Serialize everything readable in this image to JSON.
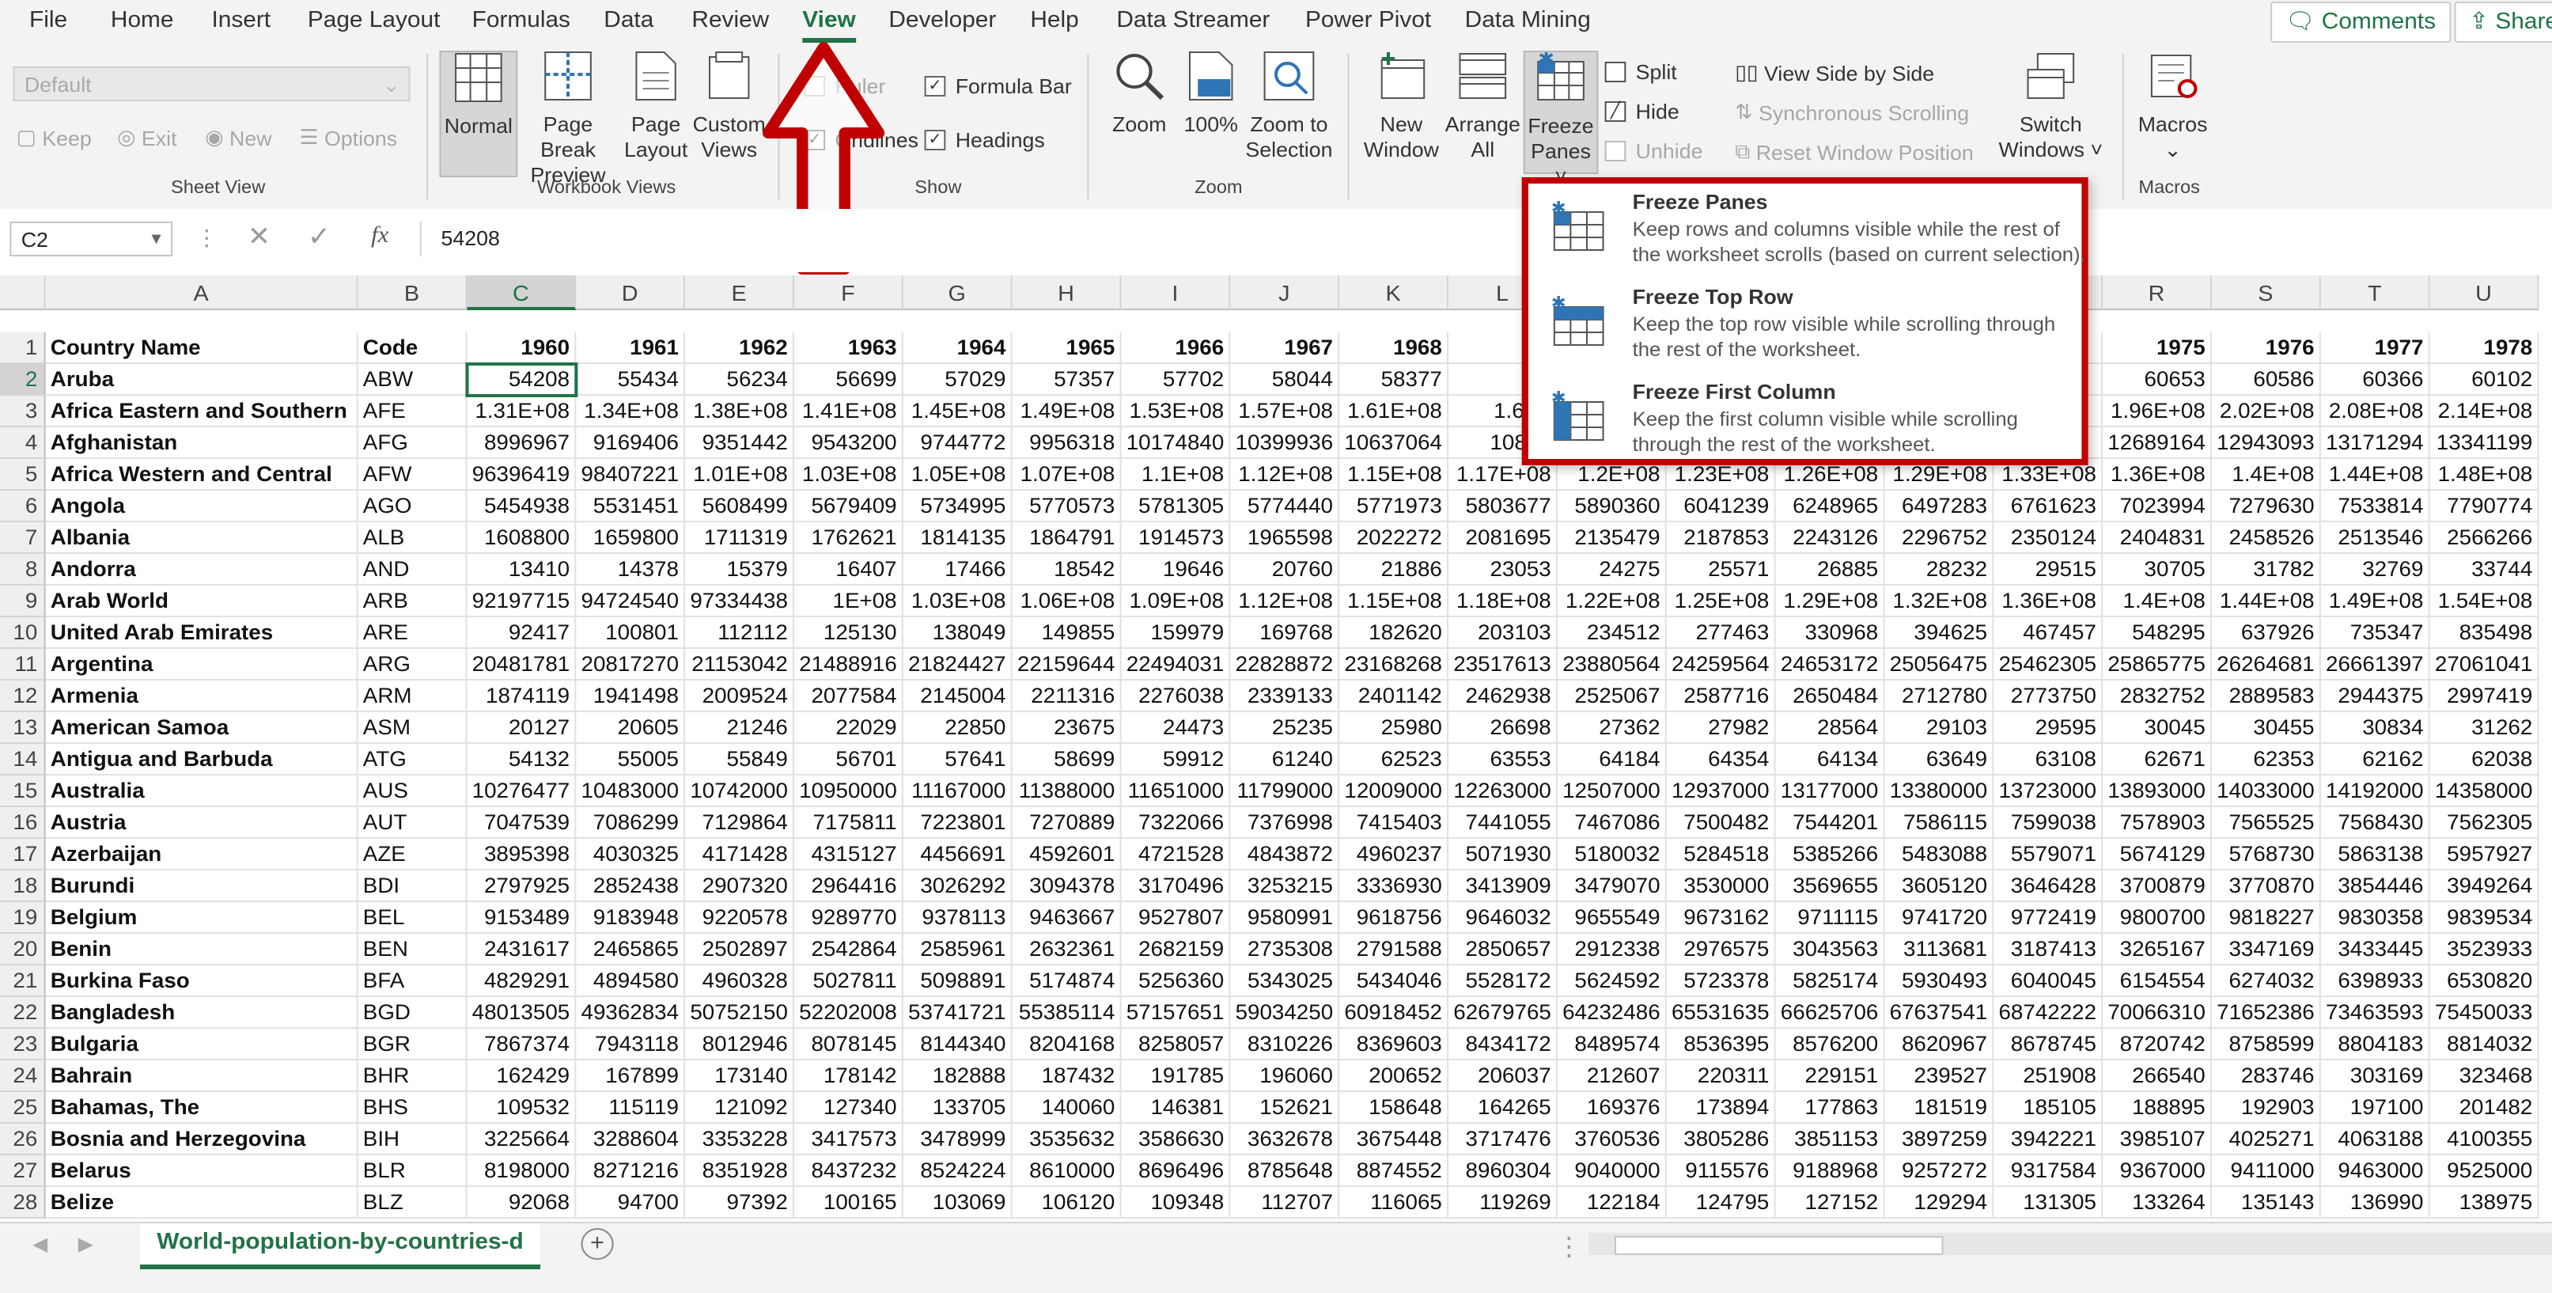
{
  "menu": {
    "tabs": [
      "File",
      "Home",
      "Insert",
      "Page Layout",
      "Formulas",
      "Data",
      "Review",
      "View",
      "Developer",
      "Help",
      "Data Streamer",
      "Power Pivot",
      "Data Mining"
    ],
    "active_tab": "View",
    "comments_label": "Comments",
    "share_label": "Share"
  },
  "ribbon": {
    "sheet_view": {
      "dropdown_value": "Default",
      "keep": "Keep",
      "exit": "Exit",
      "new": "New",
      "options": "Options",
      "group_label": "Sheet View"
    },
    "workbook_views": {
      "normal": "Normal",
      "page_break_1": "Page Break",
      "page_break_2": "Preview",
      "page_layout_1": "Page",
      "page_layout_2": "Layout",
      "custom_views_1": "Custom",
      "custom_views_2": "Views",
      "group_label": "Workbook Views"
    },
    "show": {
      "ruler": "Ruler",
      "formula_bar": "Formula Bar",
      "gridlines": "Gridlines",
      "headings": "Headings",
      "group_label": "Show"
    },
    "zoom": {
      "zoom": "Zoom",
      "hundred": "100%",
      "zoom_sel_1": "Zoom to",
      "zoom_sel_2": "Selection",
      "group_label": "Zoom"
    },
    "window": {
      "new_window_1": "New",
      "new_window_2": "Window",
      "arrange_1": "Arrange",
      "arrange_2": "All",
      "freeze_1": "Freeze",
      "freeze_2": "Panes ˅",
      "split": "Split",
      "hide": "Hide",
      "unhide": "Unhide",
      "side_by_side": "View Side by Side",
      "sync_scroll": "Synchronous Scrolling",
      "reset_pos": "Reset Window Position",
      "switch_1": "Switch",
      "switch_2": "Windows ˅"
    },
    "macros": {
      "label": "Macros",
      "group_label": "Macros"
    }
  },
  "formula_bar": {
    "name_box": "C2",
    "fx": "fx",
    "value": "54208"
  },
  "freeze_menu": {
    "items": [
      {
        "title": "Freeze Panes",
        "desc": "Keep rows and columns visible while the rest of the worksheet scrolls (based on current selection)."
      },
      {
        "title": "Freeze Top Row",
        "desc": "Keep the top row visible while scrolling through the rest of the worksheet."
      },
      {
        "title": "Freeze First Column",
        "desc": "Keep the first column visible while scrolling through the rest of the worksheet."
      }
    ]
  },
  "sheet_tab": "World-population-by-countries-d",
  "colors": {
    "accent": "#217346",
    "highlight": "#c00000"
  },
  "grid": {
    "columns": [
      "A",
      "B",
      "C",
      "D",
      "E",
      "F",
      "G",
      "H",
      "I",
      "J",
      "K",
      "L",
      "M",
      "N",
      "O",
      "P",
      "Q",
      "R",
      "S",
      "T",
      "U"
    ],
    "visible_headers": [
      "A",
      "B",
      "C",
      "D",
      "E",
      "F",
      "G",
      "H",
      "I",
      "J",
      "K",
      "L",
      "R",
      "S",
      "T",
      "U"
    ],
    "header_row": [
      "Country Name",
      "Code",
      "1960",
      "1961",
      "1962",
      "1963",
      "1964",
      "1965",
      "1966",
      "1967",
      "1968",
      "19",
      "",
      "",
      "",
      "",
      "",
      "1975",
      "1976",
      "1977",
      "1978"
    ],
    "rows": [
      [
        "Aruba",
        "ABW",
        "54208",
        "55434",
        "56234",
        "56699",
        "57029",
        "57357",
        "57702",
        "58044",
        "58377",
        "58",
        "",
        "",
        "",
        "",
        "",
        "60653",
        "60586",
        "60366",
        "60102"
      ],
      [
        "Africa Eastern and Southern",
        "AFE",
        "1.31E+08",
        "1.34E+08",
        "1.38E+08",
        "1.41E+08",
        "1.45E+08",
        "1.49E+08",
        "1.53E+08",
        "1.57E+08",
        "1.61E+08",
        "1.66E",
        "",
        "",
        "",
        "",
        "",
        "1.96E+08",
        "2.02E+08",
        "2.08E+08",
        "2.14E+08"
      ],
      [
        "Afghanistan",
        "AFG",
        "8996967",
        "9169406",
        "9351442",
        "9543200",
        "9744772",
        "9956318",
        "10174840",
        "10399936",
        "10637064",
        "10893",
        "",
        "",
        "",
        "",
        "",
        "12689164",
        "12943093",
        "13171294",
        "13341199"
      ],
      [
        "Africa Western and Central",
        "AFW",
        "96396419",
        "98407221",
        "1.01E+08",
        "1.03E+08",
        "1.05E+08",
        "1.07E+08",
        "1.1E+08",
        "1.12E+08",
        "1.15E+08",
        "1.17E+08",
        "1.2E+08",
        "1.23E+08",
        "1.26E+08",
        "1.29E+08",
        "1.33E+08",
        "1.36E+08",
        "1.4E+08",
        "1.44E+08",
        "1.48E+08"
      ],
      [
        "Angola",
        "AGO",
        "5454938",
        "5531451",
        "5608499",
        "5679409",
        "5734995",
        "5770573",
        "5781305",
        "5774440",
        "5771973",
        "5803677",
        "5890360",
        "6041239",
        "6248965",
        "6497283",
        "6761623",
        "7023994",
        "7279630",
        "7533814",
        "7790774"
      ],
      [
        "Albania",
        "ALB",
        "1608800",
        "1659800",
        "1711319",
        "1762621",
        "1814135",
        "1864791",
        "1914573",
        "1965598",
        "2022272",
        "2081695",
        "2135479",
        "2187853",
        "2243126",
        "2296752",
        "2350124",
        "2404831",
        "2458526",
        "2513546",
        "2566266"
      ],
      [
        "Andorra",
        "AND",
        "13410",
        "14378",
        "15379",
        "16407",
        "17466",
        "18542",
        "19646",
        "20760",
        "21886",
        "23053",
        "24275",
        "25571",
        "26885",
        "28232",
        "29515",
        "30705",
        "31782",
        "32769",
        "33744"
      ],
      [
        "Arab World",
        "ARB",
        "92197715",
        "94724540",
        "97334438",
        "1E+08",
        "1.03E+08",
        "1.06E+08",
        "1.09E+08",
        "1.12E+08",
        "1.15E+08",
        "1.18E+08",
        "1.22E+08",
        "1.25E+08",
        "1.29E+08",
        "1.32E+08",
        "1.36E+08",
        "1.4E+08",
        "1.44E+08",
        "1.49E+08",
        "1.54E+08"
      ],
      [
        "United Arab Emirates",
        "ARE",
        "92417",
        "100801",
        "112112",
        "125130",
        "138049",
        "149855",
        "159979",
        "169768",
        "182620",
        "203103",
        "234512",
        "277463",
        "330968",
        "394625",
        "467457",
        "548295",
        "637926",
        "735347",
        "835498"
      ],
      [
        "Argentina",
        "ARG",
        "20481781",
        "20817270",
        "21153042",
        "21488916",
        "21824427",
        "22159644",
        "22494031",
        "22828872",
        "23168268",
        "23517613",
        "23880564",
        "24259564",
        "24653172",
        "25056475",
        "25462305",
        "25865775",
        "26264681",
        "26661397",
        "27061041"
      ],
      [
        "Armenia",
        "ARM",
        "1874119",
        "1941498",
        "2009524",
        "2077584",
        "2145004",
        "2211316",
        "2276038",
        "2339133",
        "2401142",
        "2462938",
        "2525067",
        "2587716",
        "2650484",
        "2712780",
        "2773750",
        "2832752",
        "2889583",
        "2944375",
        "2997419"
      ],
      [
        "American Samoa",
        "ASM",
        "20127",
        "20605",
        "21246",
        "22029",
        "22850",
        "23675",
        "24473",
        "25235",
        "25980",
        "26698",
        "27362",
        "27982",
        "28564",
        "29103",
        "29595",
        "30045",
        "30455",
        "30834",
        "31262"
      ],
      [
        "Antigua and Barbuda",
        "ATG",
        "54132",
        "55005",
        "55849",
        "56701",
        "57641",
        "58699",
        "59912",
        "61240",
        "62523",
        "63553",
        "64184",
        "64354",
        "64134",
        "63649",
        "63108",
        "62671",
        "62353",
        "62162",
        "62038"
      ],
      [
        "Australia",
        "AUS",
        "10276477",
        "10483000",
        "10742000",
        "10950000",
        "11167000",
        "11388000",
        "11651000",
        "11799000",
        "12009000",
        "12263000",
        "12507000",
        "12937000",
        "13177000",
        "13380000",
        "13723000",
        "13893000",
        "14033000",
        "14192000",
        "14358000"
      ],
      [
        "Austria",
        "AUT",
        "7047539",
        "7086299",
        "7129864",
        "7175811",
        "7223801",
        "7270889",
        "7322066",
        "7376998",
        "7415403",
        "7441055",
        "7467086",
        "7500482",
        "7544201",
        "7586115",
        "7599038",
        "7578903",
        "7565525",
        "7568430",
        "7562305"
      ],
      [
        "Azerbaijan",
        "AZE",
        "3895398",
        "4030325",
        "4171428",
        "4315127",
        "4456691",
        "4592601",
        "4721528",
        "4843872",
        "4960237",
        "5071930",
        "5180032",
        "5284518",
        "5385266",
        "5483088",
        "5579071",
        "5674129",
        "5768730",
        "5863138",
        "5957927"
      ],
      [
        "Burundi",
        "BDI",
        "2797925",
        "2852438",
        "2907320",
        "2964416",
        "3026292",
        "3094378",
        "3170496",
        "3253215",
        "3336930",
        "3413909",
        "3479070",
        "3530000",
        "3569655",
        "3605120",
        "3646428",
        "3700879",
        "3770870",
        "3854446",
        "3949264"
      ],
      [
        "Belgium",
        "BEL",
        "9153489",
        "9183948",
        "9220578",
        "9289770",
        "9378113",
        "9463667",
        "9527807",
        "9580991",
        "9618756",
        "9646032",
        "9655549",
        "9673162",
        "9711115",
        "9741720",
        "9772419",
        "9800700",
        "9818227",
        "9830358",
        "9839534"
      ],
      [
        "Benin",
        "BEN",
        "2431617",
        "2465865",
        "2502897",
        "2542864",
        "2585961",
        "2632361",
        "2682159",
        "2735308",
        "2791588",
        "2850657",
        "2912338",
        "2976575",
        "3043563",
        "3113681",
        "3187413",
        "3265167",
        "3347169",
        "3433445",
        "3523933"
      ],
      [
        "Burkina Faso",
        "BFA",
        "4829291",
        "4894580",
        "4960328",
        "5027811",
        "5098891",
        "5174874",
        "5256360",
        "5343025",
        "5434046",
        "5528172",
        "5624592",
        "5723378",
        "5825174",
        "5930493",
        "6040045",
        "6154554",
        "6274032",
        "6398933",
        "6530820"
      ],
      [
        "Bangladesh",
        "BGD",
        "48013505",
        "49362834",
        "50752150",
        "52202008",
        "53741721",
        "55385114",
        "57157651",
        "59034250",
        "60918452",
        "62679765",
        "64232486",
        "65531635",
        "66625706",
        "67637541",
        "68742222",
        "70066310",
        "71652386",
        "73463593",
        "75450033"
      ],
      [
        "Bulgaria",
        "BGR",
        "7867374",
        "7943118",
        "8012946",
        "8078145",
        "8144340",
        "8204168",
        "8258057",
        "8310226",
        "8369603",
        "8434172",
        "8489574",
        "8536395",
        "8576200",
        "8620967",
        "8678745",
        "8720742",
        "8758599",
        "8804183",
        "8814032"
      ],
      [
        "Bahrain",
        "BHR",
        "162429",
        "167899",
        "173140",
        "178142",
        "182888",
        "187432",
        "191785",
        "196060",
        "200652",
        "206037",
        "212607",
        "220311",
        "229151",
        "239527",
        "251908",
        "266540",
        "283746",
        "303169",
        "323468"
      ],
      [
        "Bahamas, The",
        "BHS",
        "109532",
        "115119",
        "121092",
        "127340",
        "133705",
        "140060",
        "146381",
        "152621",
        "158648",
        "164265",
        "169376",
        "173894",
        "177863",
        "181519",
        "185105",
        "188895",
        "192903",
        "197100",
        "201482"
      ],
      [
        "Bosnia and Herzegovina",
        "BIH",
        "3225664",
        "3288604",
        "3353228",
        "3417573",
        "3478999",
        "3535632",
        "3586630",
        "3632678",
        "3675448",
        "3717476",
        "3760536",
        "3805286",
        "3851153",
        "3897259",
        "3942221",
        "3985107",
        "4025271",
        "4063188",
        "4100355"
      ],
      [
        "Belarus",
        "BLR",
        "8198000",
        "8271216",
        "8351928",
        "8437232",
        "8524224",
        "8610000",
        "8696496",
        "8785648",
        "8874552",
        "8960304",
        "9040000",
        "9115576",
        "9188968",
        "9257272",
        "9317584",
        "9367000",
        "9411000",
        "9463000",
        "9525000"
      ],
      [
        "Belize",
        "BLZ",
        "92068",
        "94700",
        "97392",
        "100165",
        "103069",
        "106120",
        "109348",
        "112707",
        "116065",
        "119269",
        "122184",
        "124795",
        "127152",
        "129294",
        "131305",
        "133264",
        "135143",
        "136990",
        "138975"
      ]
    ]
  }
}
